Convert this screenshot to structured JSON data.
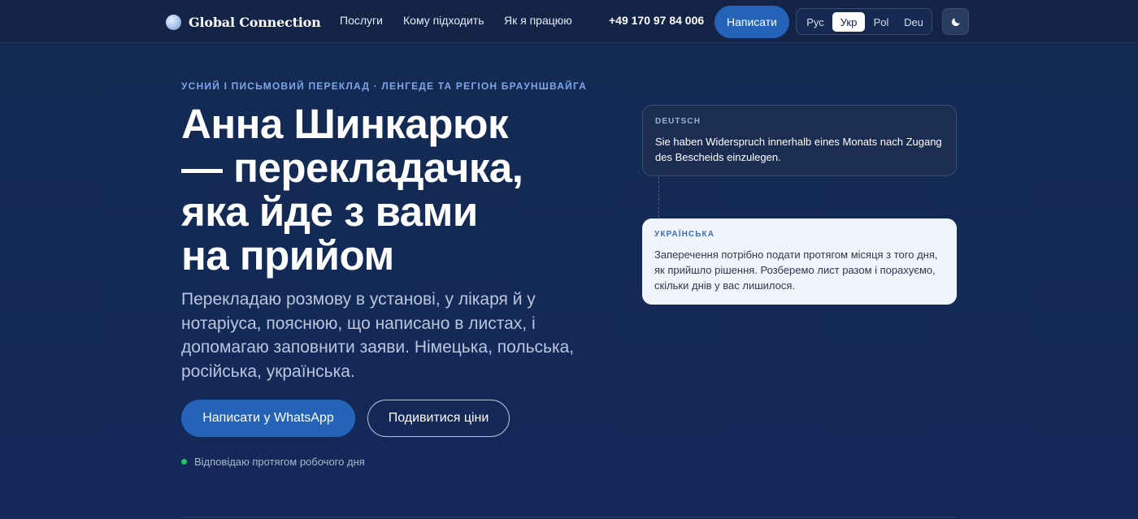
{
  "header": {
    "brand": "Global Connection",
    "nav": [
      "Послуги",
      "Кому підходить",
      "Як я працюю"
    ],
    "phone": "+49 170 97 84 006",
    "write_label": "Написати",
    "languages": [
      "Рус",
      "Укр",
      "Pol",
      "Deu"
    ],
    "active_language": "Укр",
    "theme_icon": "moon-icon"
  },
  "hero": {
    "eyebrow": "УСНИЙ І ПИСЬМОВИЙ ПЕРЕКЛАД · ЛЕНГЕДЕ ТА РЕГІОН БРАУНШВАЙГА",
    "title_lines": [
      "Анна Шинкарюк",
      "— перекладачка,",
      "яка йде з вами",
      "на прийом"
    ],
    "subtitle": "Перекладаю розмову в установі, у лікаря й у нотаріуса, пояснюю, що написано в листах, і допомагаю заповнити заяви. Німецька, польська, російська, українська.",
    "cta_primary": "Написати у WhatsApp",
    "cta_secondary": "Подивитися ціни",
    "status": "Відповідаю протягом робочого дня"
  },
  "cards": {
    "de": {
      "label": "DEUTSCH",
      "text": "Sie haben Widerspruch innerhalb eines Monats nach Zugang des Bescheids einzulegen."
    },
    "uk": {
      "label": "УКРАЇНСЬКА",
      "text": "Заперечення потрібно подати протягом місяця з того дня, як прийшло рішення. Розберемо лист разом і порахуємо, скільки днів у вас лишилося."
    }
  },
  "colors": {
    "background": "#13284f",
    "accent": "#2563b8",
    "eyebrow": "#7ea6e8",
    "status_dot": "#22c55e"
  }
}
